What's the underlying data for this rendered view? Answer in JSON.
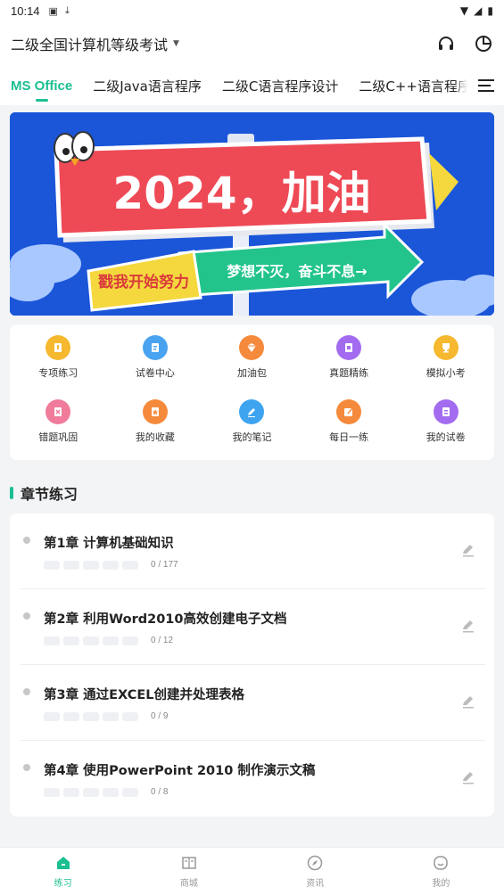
{
  "statusbar": {
    "time": "10:14"
  },
  "header": {
    "title": "二级全国计算机等级考试"
  },
  "tabs": [
    {
      "label": "MS Office",
      "active": true
    },
    {
      "label": "二级Java语言程序"
    },
    {
      "label": "二级C语言程序设计"
    },
    {
      "label": "二级C++语言程序设计"
    }
  ],
  "banner": {
    "headline": "2024，加油",
    "left_slogan": "戳我开始努力",
    "right_slogan": "梦想不灭，奋斗不息→"
  },
  "grid": [
    {
      "label": "专项练习",
      "color": "#f5b82e",
      "icon": "practice-icon"
    },
    {
      "label": "试卷中心",
      "color": "#4aa3f0",
      "icon": "paper-icon"
    },
    {
      "label": "加油包",
      "color": "#f58a3c",
      "icon": "pack-icon"
    },
    {
      "label": "真题精练",
      "color": "#a36cf0",
      "icon": "real-exam-icon"
    },
    {
      "label": "模拟小考",
      "color": "#f5b82e",
      "icon": "trophy-icon"
    },
    {
      "label": "错题巩固",
      "color": "#f07b9a",
      "icon": "wrong-question-icon"
    },
    {
      "label": "我的收藏",
      "color": "#f58a3c",
      "icon": "favorite-icon"
    },
    {
      "label": "我的笔记",
      "color": "#3ea4f0",
      "icon": "note-icon"
    },
    {
      "label": "每日一练",
      "color": "#f58a3c",
      "icon": "daily-icon"
    },
    {
      "label": "我的试卷",
      "color": "#a36cf0",
      "icon": "my-paper-icon"
    }
  ],
  "section": {
    "title": "章节练习"
  },
  "chapters": [
    {
      "name": "第1章 计算机基础知识",
      "count": "0 / 177"
    },
    {
      "name": "第2章 利用Word2010高效创建电子文档",
      "count": "0 / 12"
    },
    {
      "name": "第3章 通过EXCEL创建并处理表格",
      "count": "0 / 9"
    },
    {
      "name": "第4章 使用PowerPoint 2010 制作演示文稿",
      "count": "0 / 8"
    }
  ],
  "bottomnav": [
    {
      "label": "练习",
      "icon": "home-icon",
      "active": true
    },
    {
      "label": "商城",
      "icon": "shop-icon"
    },
    {
      "label": "资讯",
      "icon": "compass-icon"
    },
    {
      "label": "我的",
      "icon": "profile-icon"
    }
  ],
  "colors": {
    "accent": "#1bbf92"
  }
}
